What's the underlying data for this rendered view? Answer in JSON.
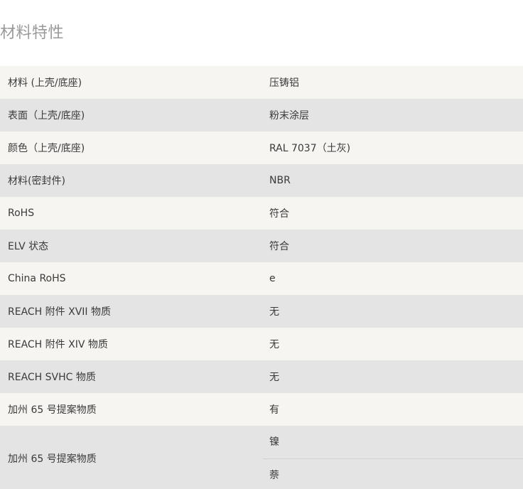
{
  "section_title": "材料特性",
  "rows": [
    {
      "property": "材料 (上壳/底座)",
      "value": "压铸铝"
    },
    {
      "property": "表面（上壳/底座)",
      "value": "粉末涂层"
    },
    {
      "property": "颜色（上壳/底座)",
      "value": "RAL 7037（土灰)"
    },
    {
      "property": "材料(密封件)",
      "value": "NBR"
    },
    {
      "property": "RoHS",
      "value": "符合"
    },
    {
      "property": "ELV 状态",
      "value": "符合"
    },
    {
      "property": "China RoHS",
      "value": "e"
    },
    {
      "property": "REACH 附件 XVII 物质",
      "value": "无"
    },
    {
      "property": "REACH 附件 XIV 物质",
      "value": "无"
    },
    {
      "property": "REACH SVHC 物质",
      "value": "无"
    },
    {
      "property": "加州 65 号提案物质",
      "value": "有"
    }
  ],
  "last_row": {
    "property": "加州 65 号提案物质",
    "values": [
      "镍",
      "萘"
    ]
  }
}
